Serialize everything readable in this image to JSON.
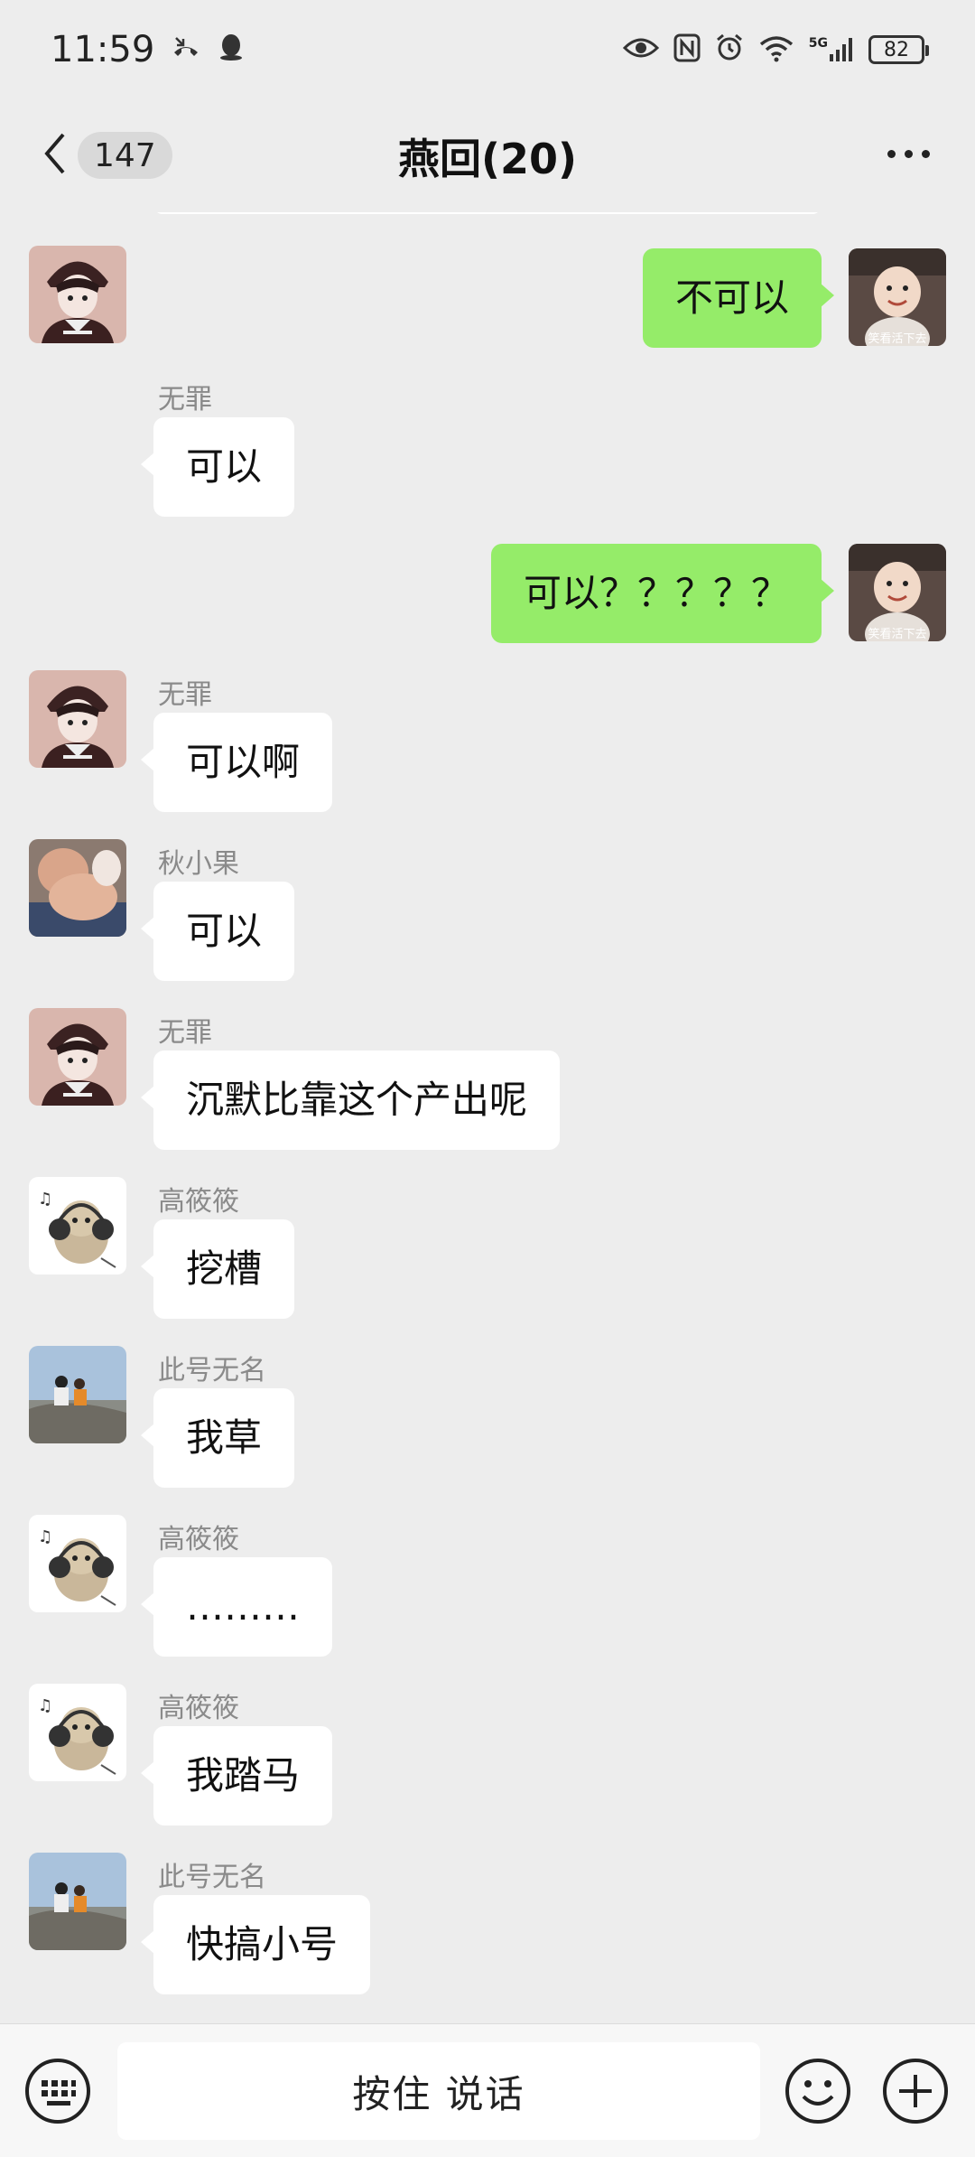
{
  "status_bar": {
    "time": "11:59",
    "network": "5G",
    "battery": "82"
  },
  "nav": {
    "unread_count": "147",
    "title": "燕回(20)"
  },
  "messages": [
    {
      "side": "right",
      "text": "不可以",
      "sticker_caption": "笑看活下去"
    },
    {
      "side": "left",
      "sender": "无罪",
      "text": "可以"
    },
    {
      "side": "right",
      "text": "可以？？？？？",
      "sticker_caption": "笑看活下去"
    },
    {
      "side": "left",
      "sender": "无罪",
      "text": "可以啊"
    },
    {
      "side": "left",
      "sender": "秋小果",
      "text": "可以"
    },
    {
      "side": "left",
      "sender": "无罪",
      "text": "沉默比靠这个产出呢"
    },
    {
      "side": "left",
      "sender": "高筱筱",
      "text": "挖槽"
    },
    {
      "side": "left",
      "sender": "此号无名",
      "text": "我草"
    },
    {
      "side": "left",
      "sender": "高筱筱",
      "text": "………"
    },
    {
      "side": "left",
      "sender": "高筱筱",
      "text": "我踏马"
    },
    {
      "side": "left",
      "sender": "此号无名",
      "text": "快搞小号"
    }
  ],
  "input_bar": {
    "hold_to_talk": "按住 说话"
  },
  "colors": {
    "background": "#ededed",
    "self_bubble": "#95ec69",
    "other_bubble": "#ffffff"
  }
}
